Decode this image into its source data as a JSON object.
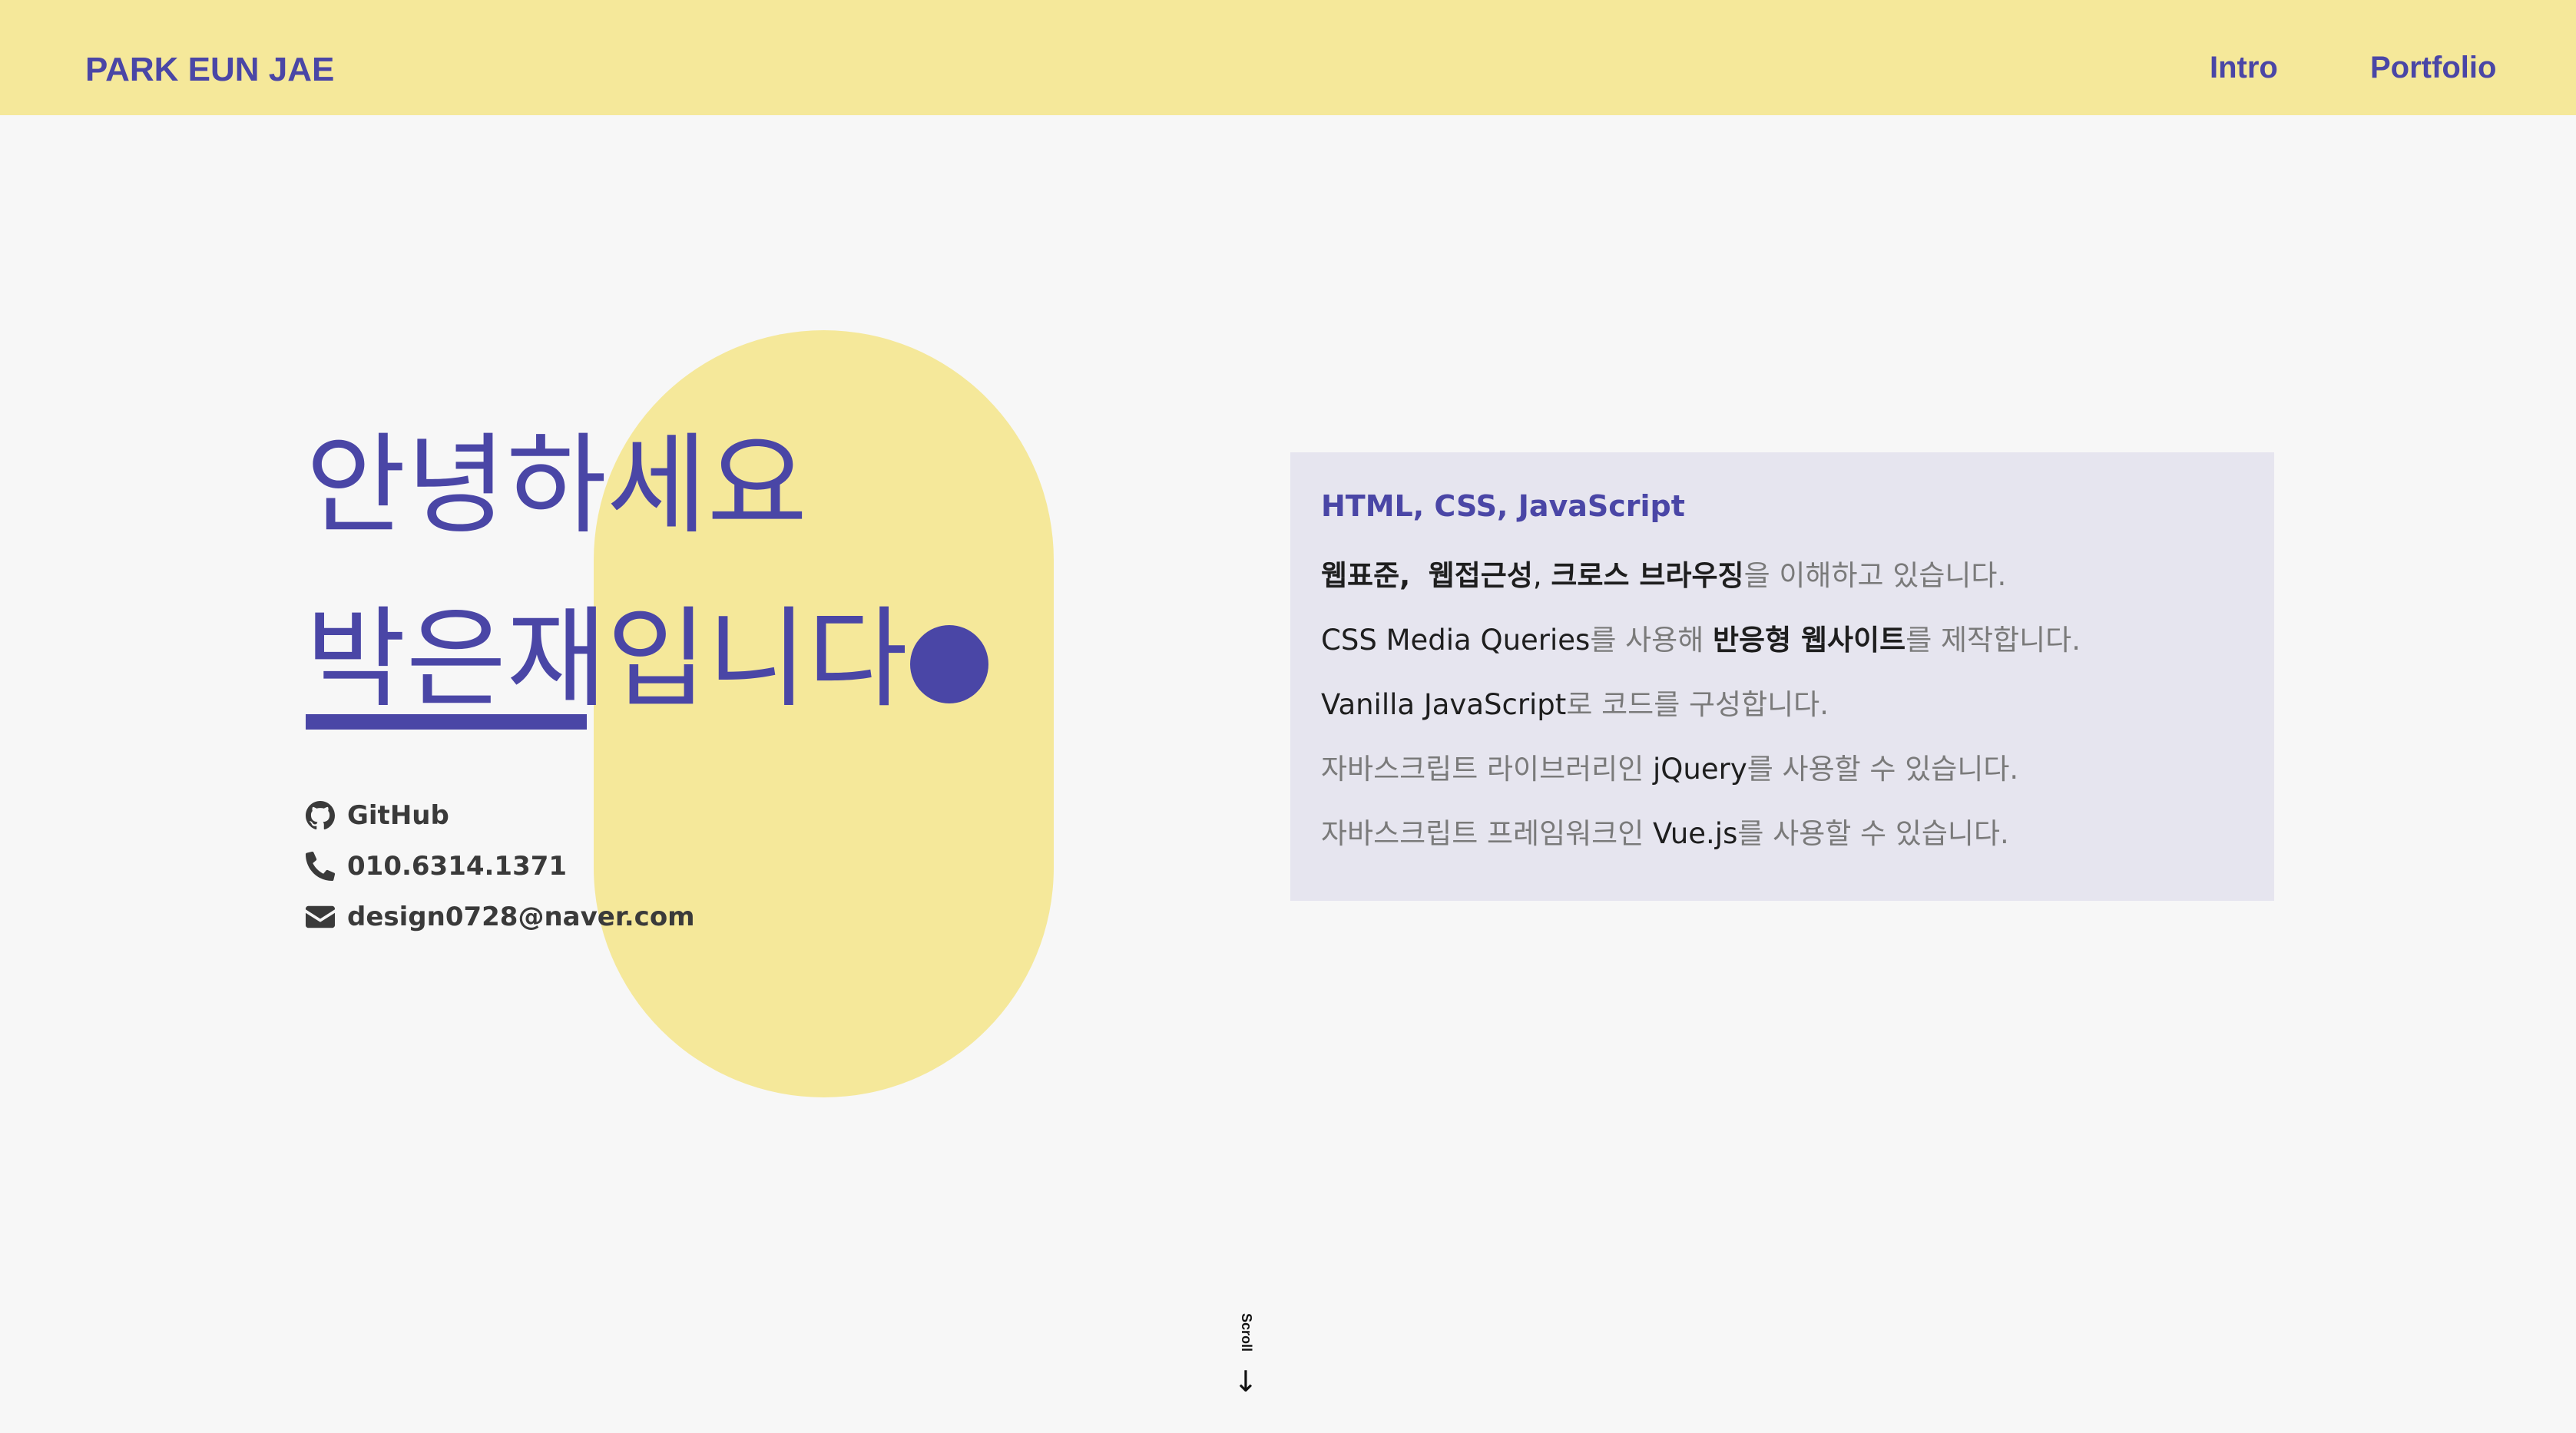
{
  "header": {
    "logo": "PARK EUN JAE",
    "nav": [
      {
        "label": "Intro"
      },
      {
        "label": "Portfolio"
      }
    ]
  },
  "hero": {
    "line1": "안녕하세요",
    "name": "박은재",
    "name_suffix": "입니다"
  },
  "contacts": {
    "github": {
      "label": "GitHub",
      "icon": "github-icon"
    },
    "phone": {
      "label": "010.6314.1371",
      "icon": "phone-icon"
    },
    "email": {
      "label": "design0728@naver.com",
      "icon": "envelope-icon"
    }
  },
  "skills": {
    "title": "HTML, CSS, JavaScript",
    "items": [
      {
        "parts": [
          "웹표준,",
          "웹접근성",
          ", ",
          "크로스 브라우징",
          "을 이해하고 있습니다."
        ]
      },
      {
        "parts": [
          "CSS Media Queries",
          "를 사용해 ",
          "반응형 웹사이트",
          "를 제작합니다."
        ]
      },
      {
        "parts": [
          "Vanilla JavaScript",
          "로 코드를 구성합니다."
        ]
      },
      {
        "parts": [
          "자바스크립트 라이브러리인 ",
          "jQuery",
          "를 사용할 수 있습니다."
        ]
      },
      {
        "parts": [
          "자바스크립트 프레임워크인 ",
          "Vue.js",
          "를 사용할 수 있습니다."
        ]
      }
    ]
  },
  "scroll": {
    "label": "Scroll",
    "arrow": "↓"
  },
  "colors": {
    "accent": "#4a46a6",
    "yellow": "#f5e89a",
    "background": "#f7f7f7",
    "card": "#e6e5ef"
  }
}
